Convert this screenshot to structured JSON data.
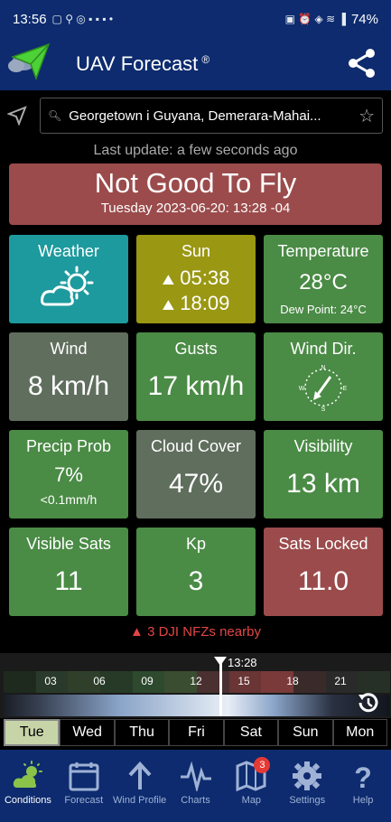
{
  "status_bar": {
    "time": "13:56",
    "battery": "74%"
  },
  "app_bar": {
    "title": "UAV Forecast",
    "trademark": "®"
  },
  "search": {
    "location": "Georgetown i Guyana, Demerara-Mahai..."
  },
  "last_update": "Last update: a few seconds ago",
  "verdict": {
    "text": "Not Good To Fly",
    "datetime": "Tuesday 2023-06-20: 13:28 -04"
  },
  "tiles": {
    "weather": {
      "label": "Weather"
    },
    "sun": {
      "label": "Sun",
      "sunrise": "05:38",
      "sunset": "18:09"
    },
    "temperature": {
      "label": "Temperature",
      "value": "28°C",
      "dew_point": "Dew Point: 24°C"
    },
    "wind": {
      "label": "Wind",
      "value": "8 km/h"
    },
    "gusts": {
      "label": "Gusts",
      "value": "17 km/h"
    },
    "wind_dir": {
      "label": "Wind Dir."
    },
    "precip": {
      "label": "Precip Prob",
      "value": "7%",
      "amount": "<0.1mm/h"
    },
    "cloud": {
      "label": "Cloud Cover",
      "value": "47%"
    },
    "visibility": {
      "label": "Visibility",
      "value": "13 km"
    },
    "sats": {
      "label": "Visible Sats",
      "value": "11"
    },
    "kp": {
      "label": "Kp",
      "value": "3"
    },
    "locked": {
      "label": "Sats Locked",
      "value": "11.0"
    }
  },
  "nfz_warning": "3 DJI NFZs nearby",
  "timeline": {
    "current_time": "13:28",
    "ticks": [
      "03",
      "06",
      "09",
      "12",
      "15",
      "18",
      "21"
    ]
  },
  "days": [
    "Tue",
    "Wed",
    "Thu",
    "Fri",
    "Sat",
    "Sun",
    "Mon"
  ],
  "nav": {
    "conditions": "Conditions",
    "forecast": "Forecast",
    "wind_profile": "Wind Profile",
    "charts": "Charts",
    "map": "Map",
    "map_badge": "3",
    "settings": "Settings",
    "help": "Help"
  },
  "colors": {
    "bar": "#0d2b6e",
    "bad": "#9b4b4b",
    "good": "#4a8b45",
    "teal": "#1d9a9e",
    "olive": "#9a9713"
  }
}
